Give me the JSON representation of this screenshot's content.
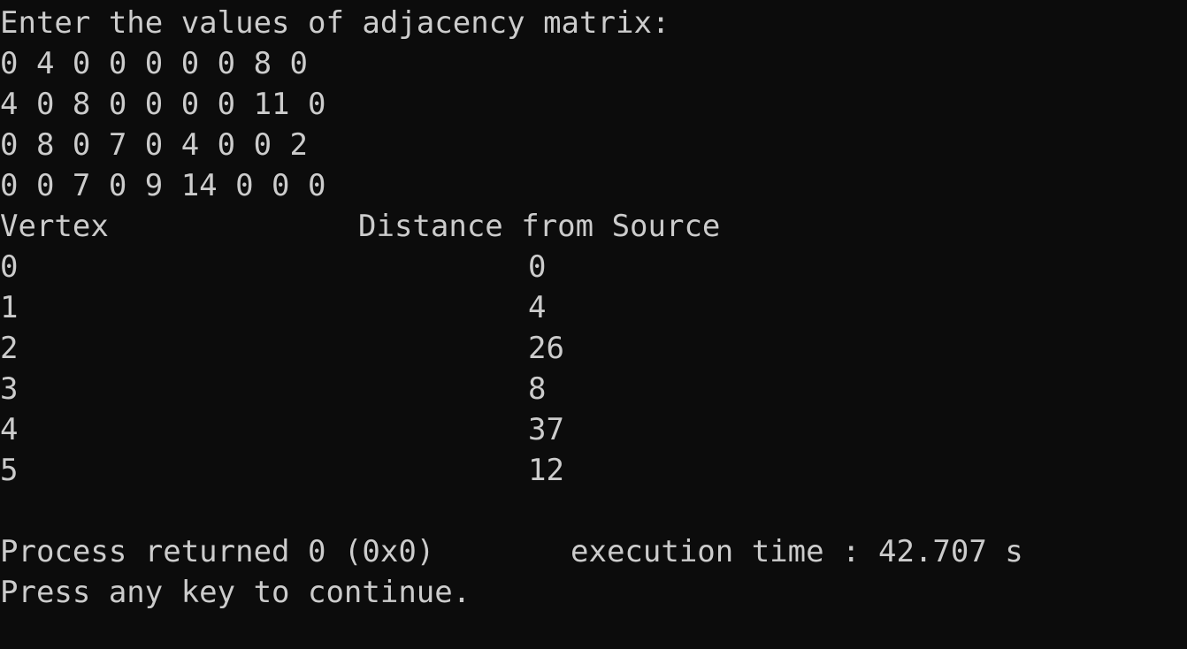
{
  "console": {
    "prompt": "Enter the values of adjacency matrix:",
    "matrix_rows": [
      "0 4 0 0 0 0 0 8 0",
      "4 0 8 0 0 0 0 11 0",
      "0 8 0 7 0 4 0 0 2",
      "0 0 7 0 9 14 0 0 0"
    ],
    "table_header": {
      "vertex": "Vertex",
      "distance": "Distance from Source"
    },
    "rows": [
      {
        "vertex": "0",
        "distance": "0"
      },
      {
        "vertex": "1",
        "distance": "4"
      },
      {
        "vertex": "2",
        "distance": "26"
      },
      {
        "vertex": "3",
        "distance": "8"
      },
      {
        "vertex": "4",
        "distance": "37"
      },
      {
        "vertex": "5",
        "distance": "12"
      }
    ],
    "process_returned": "Process returned 0 (0x0)",
    "execution_time": "execution time : 42.707 s",
    "press_key": "Press any key to continue."
  }
}
